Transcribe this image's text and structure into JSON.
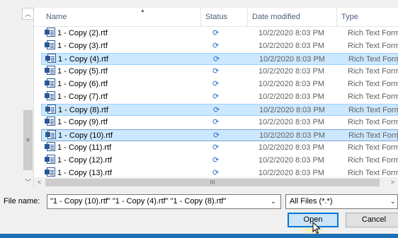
{
  "columns": {
    "name": "Name",
    "status": "Status",
    "date": "Date modified",
    "type": "Type"
  },
  "files": [
    {
      "name": "1 - Copy (2).rtf",
      "status": "sync-icon",
      "date": "10/2/2020 8:03 PM",
      "type": "Rich Text Format"
    },
    {
      "name": "1 - Copy (3).rtf",
      "status": "sync-icon",
      "date": "10/2/2020 8:03 PM",
      "type": "Rich Text Format"
    },
    {
      "name": "1 - Copy (4).rtf",
      "status": "sync-icon",
      "date": "10/2/2020 8:03 PM",
      "type": "Rich Text Format",
      "selected": true
    },
    {
      "name": "1 - Copy (5).rtf",
      "status": "sync-icon",
      "date": "10/2/2020 8:03 PM",
      "type": "Rich Text Format"
    },
    {
      "name": "1 - Copy (6).rtf",
      "status": "sync-icon",
      "date": "10/2/2020 8:03 PM",
      "type": "Rich Text Format"
    },
    {
      "name": "1 - Copy (7).rtf",
      "status": "sync-icon",
      "date": "10/2/2020 8:03 PM",
      "type": "Rich Text Format"
    },
    {
      "name": "1 - Copy (8).rtf",
      "status": "sync-icon",
      "date": "10/2/2020 8:03 PM",
      "type": "Rich Text Format",
      "selected": true
    },
    {
      "name": "1 - Copy (9).rtf",
      "status": "sync-icon",
      "date": "10/2/2020 8:03 PM",
      "type": "Rich Text Format"
    },
    {
      "name": "1 - Copy (10).rtf",
      "status": "sync-icon",
      "date": "10/2/2020 8:03 PM",
      "type": "Rich Text Format",
      "selected": true,
      "focused": true
    },
    {
      "name": "1 - Copy (11).rtf",
      "status": "sync-icon",
      "date": "10/2/2020 8:03 PM",
      "type": "Rich Text Format"
    },
    {
      "name": "1 - Copy (12).rtf",
      "status": "sync-icon",
      "date": "10/2/2020 8:03 PM",
      "type": "Rich Text Format"
    },
    {
      "name": "1 - Copy (13).rtf",
      "status": "sync-icon",
      "date": "10/2/2020 8:03 PM",
      "type": "Rich Text Format"
    }
  ],
  "bottom": {
    "file_name_label": "File name:",
    "file_name_value": "\"1 - Copy (10).rtf\" \"1 - Copy (4).rtf\" \"1 - Copy (8).rtf\"",
    "file_type_value": "All Files (*.*)",
    "open_label": "Open",
    "cancel_label": "Cancel"
  },
  "colors": {
    "selection": "#cce8ff",
    "accent": "#0078d7",
    "sync": "#2f6cc8"
  }
}
